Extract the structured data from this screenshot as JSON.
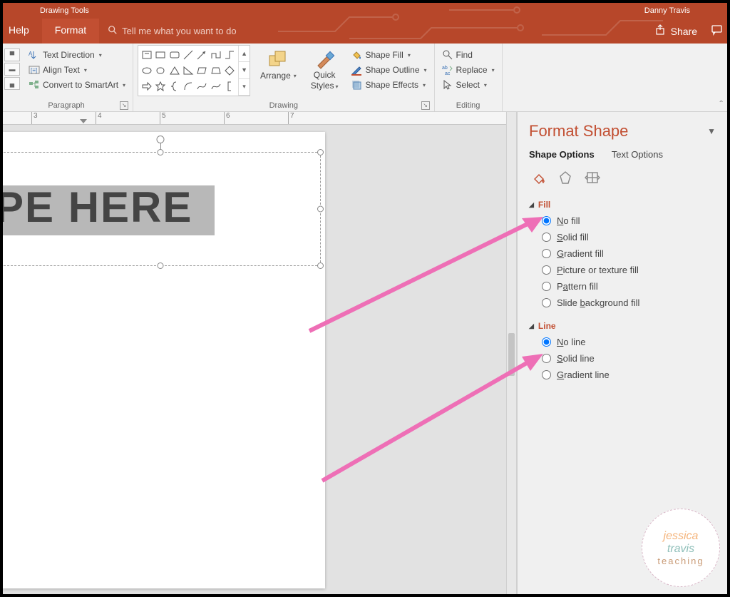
{
  "titlebar": {
    "left_label": "Drawing Tools",
    "right_label": "Danny Travis"
  },
  "tabs": {
    "help": "Help",
    "format": "Format",
    "tellme": "Tell me what you want to do",
    "share": "Share"
  },
  "ribbon": {
    "paragraph_label": "Paragraph",
    "text_direction": "Text Direction",
    "align_text": "Align Text",
    "convert_smartart": "Convert to SmartArt",
    "drawing_label": "Drawing",
    "arrange": "Arrange",
    "quick_styles_line1": "Quick",
    "quick_styles_line2": "Styles",
    "shape_fill": "Shape Fill",
    "shape_outline": "Shape Outline",
    "shape_effects": "Shape Effects",
    "editing_label": "Editing",
    "find": "Find",
    "replace": "Replace",
    "select": "Select"
  },
  "ruler": {
    "t3": "3",
    "t4": "4",
    "t5": "5",
    "t6": "6",
    "t7": "7"
  },
  "slide": {
    "bigtext": "PE HERE"
  },
  "pane": {
    "title": "Format Shape",
    "shape_options": "Shape Options",
    "text_options": "Text Options",
    "fill_header": "Fill",
    "line_header": "Line",
    "fill_options": {
      "no_fill": "No fill",
      "solid": "Solid fill",
      "gradient": "Gradient fill",
      "picture": "Picture or texture fill",
      "pattern": "Pattern fill",
      "slidebg": "Slide background fill"
    },
    "line_options": {
      "no_line": "No line",
      "solid": "Solid line",
      "gradient": "Gradient line"
    },
    "underline_first": {
      "no_fill": "N",
      "solid": "S",
      "gradient": "G",
      "picture": "P",
      "pattern": "P",
      "slidebg": "b",
      "no_line": "N",
      "solid_line": "S",
      "gradient_line": "G"
    }
  },
  "watermark": {
    "l1": "jessica",
    "l2": "travis",
    "l3": "teaching"
  }
}
